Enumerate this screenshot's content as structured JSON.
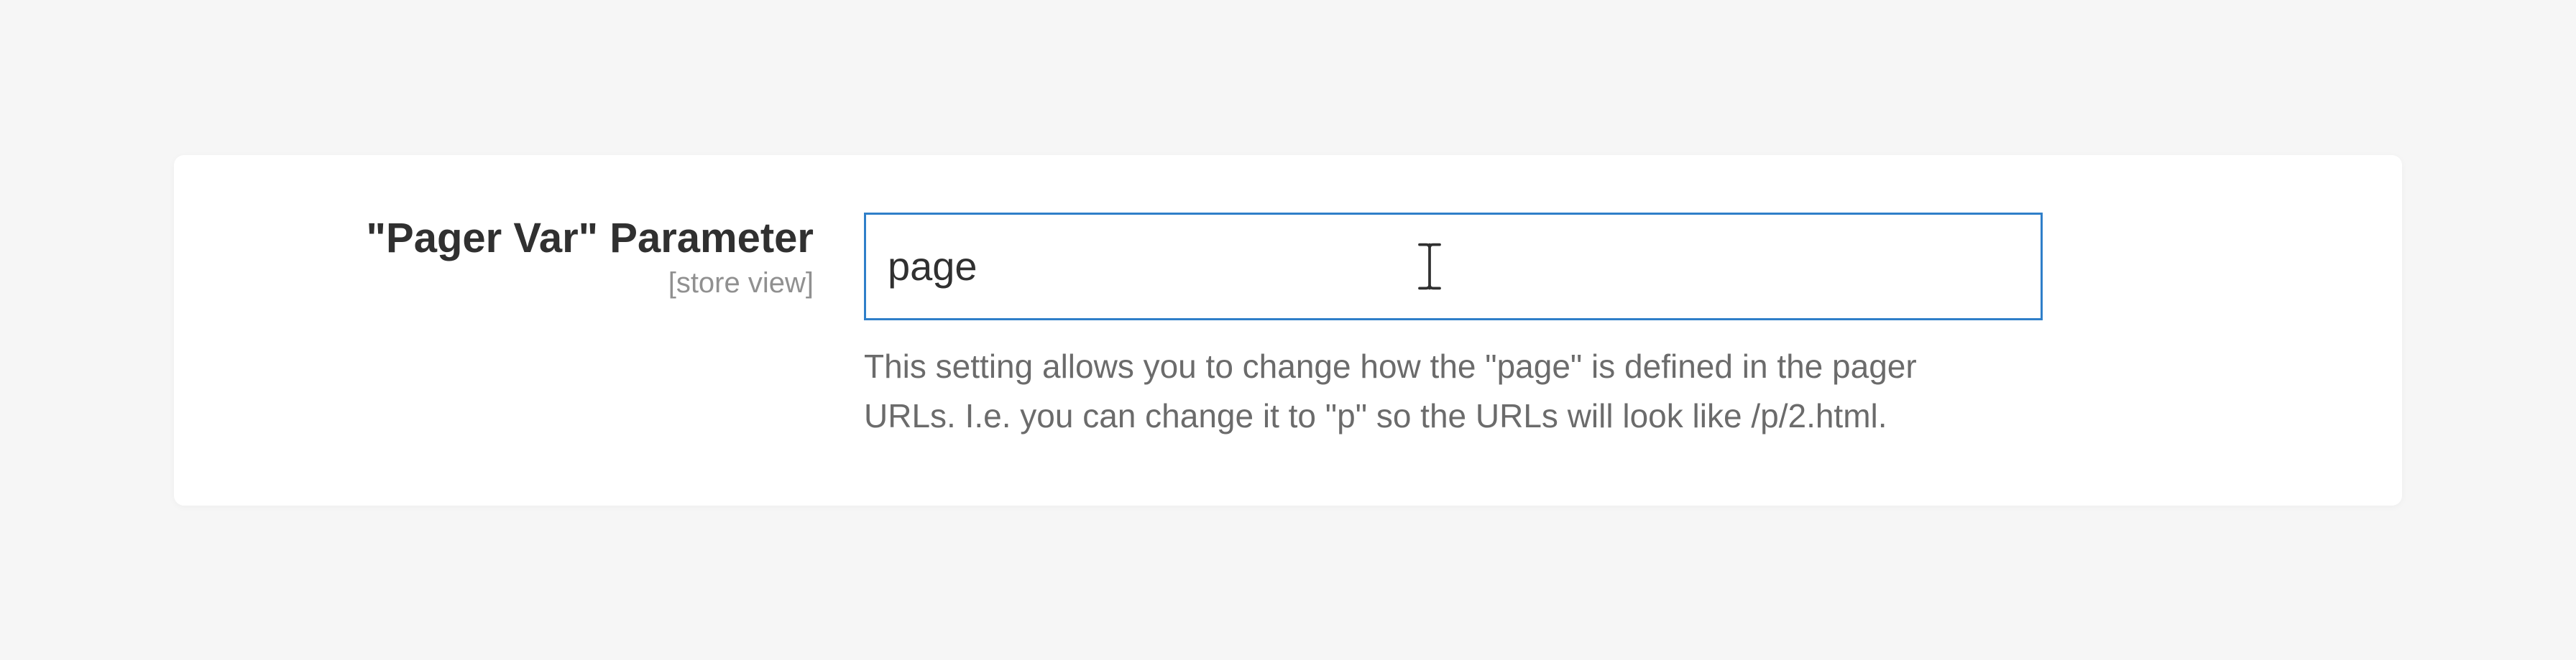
{
  "field": {
    "label": "\"Pager Var\" Parameter",
    "scope": "[store view]",
    "value": "page",
    "note": "This setting allows you to change how the \"page\" is defined in the pager URLs. I.e. you can change it to \"p\" so the URLs will look like /p/2.html."
  }
}
